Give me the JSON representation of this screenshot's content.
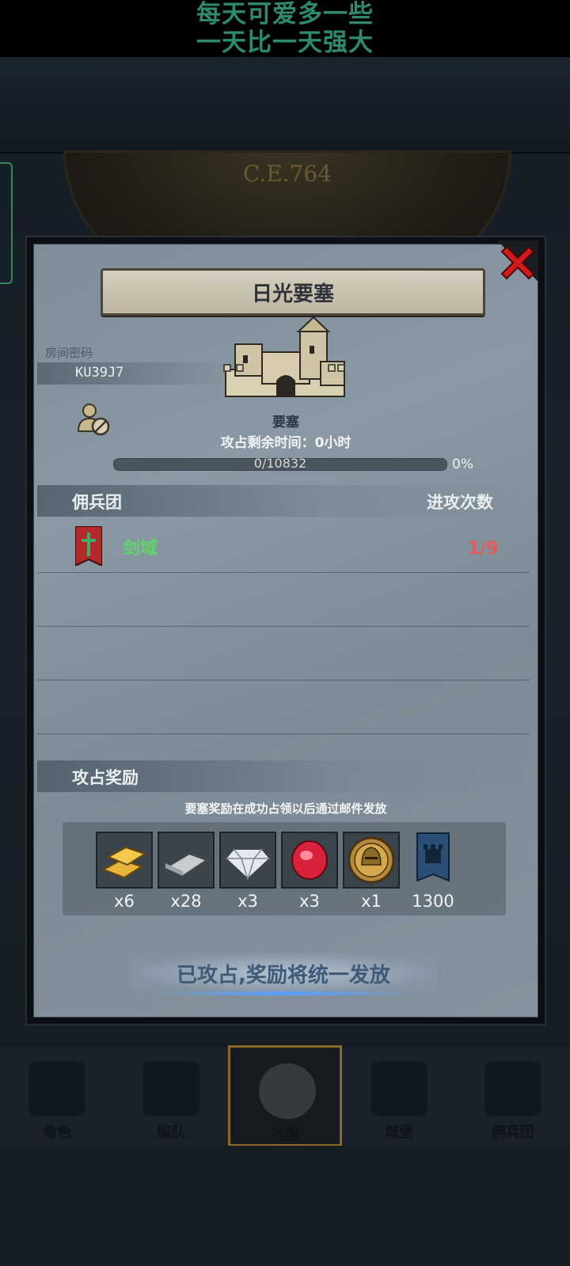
{
  "overlay": {
    "line1": "每天可爱多一些",
    "line2": "一天比一天强大"
  },
  "backdrop": {
    "dial_year": "C.E.764"
  },
  "modal": {
    "title": "日光要塞",
    "room_label": "房间密码",
    "room_code": "KU39J7",
    "castle_name": "要塞",
    "time_left": "攻占剩余时间：0小时",
    "progress": {
      "text": "0/10832",
      "percent_label": "0%",
      "value": 0
    },
    "mercenary_section": {
      "title": "佣兵团",
      "attacks_header": "进攻次数",
      "rows": [
        {
          "name": "剑域",
          "count": "1/9"
        }
      ]
    },
    "reward_section": {
      "title": "攻占奖励",
      "note": "要塞奖励在成功占领以后通过邮件发放",
      "items": [
        {
          "icon": "gold-bar-icon",
          "qty": "x6"
        },
        {
          "icon": "iron-bar-icon",
          "qty": "x28"
        },
        {
          "icon": "diamond-icon",
          "qty": "x3"
        },
        {
          "icon": "ruby-icon",
          "qty": "x3"
        },
        {
          "icon": "helmet-coin-icon",
          "qty": "x1"
        },
        {
          "icon": "castle-banner-icon",
          "qty": "1300"
        }
      ]
    },
    "claim_label": "已攻占,奖励将统一发放"
  },
  "bottom_nav": [
    {
      "label": "角色"
    },
    {
      "label": "编队"
    },
    {
      "label": "地图",
      "active": true
    },
    {
      "label": "城堡"
    },
    {
      "label": "佣兵团"
    }
  ],
  "colors": {
    "overlay_text": "#2e8b6a",
    "merc_name": "#5fd46b",
    "attack_count": "#e65a5a",
    "active_tab_border": "#8a6a26"
  }
}
